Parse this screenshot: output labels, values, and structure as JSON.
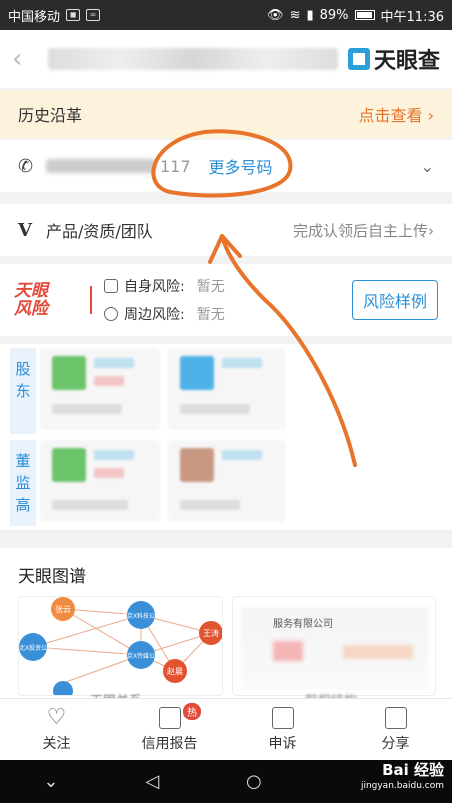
{
  "status": {
    "carrier": "中国移动",
    "battery": "89%",
    "time": "中午11:36"
  },
  "topbar": {
    "brand": "天眼查"
  },
  "history": {
    "label": "历史沿革",
    "cta": "点击查看"
  },
  "phone": {
    "tail": "117",
    "more": "更多号码"
  },
  "product": {
    "label": "产品/资质/团队",
    "hint": "完成认领后自主上传"
  },
  "risk": {
    "logo_line1": "天眼",
    "logo_line2": "风险",
    "self_label": "自身风险:",
    "self_value": "暂无",
    "around_label": "周边风险:",
    "around_value": "暂无",
    "button": "风险样例"
  },
  "people": {
    "shareholders": "股东",
    "directors": "董监高"
  },
  "graph": {
    "title": "天眼图谱",
    "caption": "天眼关系",
    "rel_caption": "股权结构",
    "rel_company": "服务有限公司",
    "nodes": [
      "张云",
      "北京X科技公司",
      "王涛",
      "河北X投资公司",
      "北京X传媒公司",
      "赵晨"
    ]
  },
  "tabs": [
    {
      "label": "关注",
      "icon": "heart-icon"
    },
    {
      "label": "信用报告",
      "icon": "report-icon",
      "badge": "热"
    },
    {
      "label": "申诉",
      "icon": "edit-icon"
    },
    {
      "label": "分享",
      "icon": "share-icon"
    }
  ],
  "watermark": {
    "main": "Bai 经验",
    "sub": "jingyan.baidu.com"
  },
  "colors": {
    "accent": "#2b8fd8",
    "orange": "#e8742c",
    "risk_red": "#e24a3b",
    "history_bg": "#fdf3dc"
  }
}
